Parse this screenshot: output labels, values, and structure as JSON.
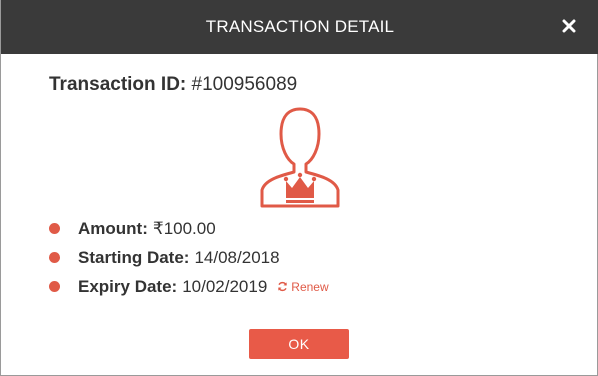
{
  "header": {
    "title": "TRANSACTION DETAIL",
    "close_icon": "close-icon"
  },
  "transaction": {
    "id_label": "Transaction ID:",
    "id_value": "#100956089"
  },
  "avatar_icon": "premium-user-crown-icon",
  "details": [
    {
      "label": "Amount:",
      "value": "₹100.00"
    },
    {
      "label": "Starting Date:",
      "value": "14/08/2018"
    },
    {
      "label": "Expiry Date:",
      "value": "10/02/2019"
    }
  ],
  "renew": {
    "label": "Renew",
    "icon": "refresh-icon"
  },
  "ok_button": {
    "label": "OK"
  },
  "colors": {
    "header_bg": "#3a3a3a",
    "accent": "#e85a48",
    "text": "#333333"
  }
}
